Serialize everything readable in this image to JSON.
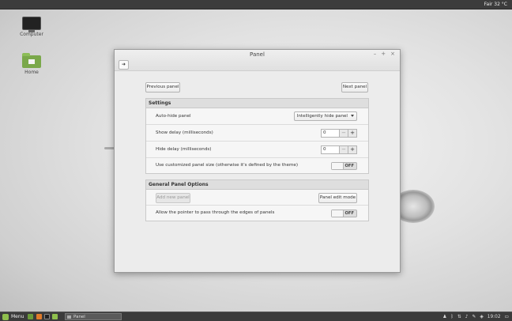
{
  "top_panel": {
    "weather": "Fair 32 °C"
  },
  "desktop": {
    "icons": [
      {
        "label": "Computer",
        "icon": "computer-icon"
      },
      {
        "label": "Home",
        "icon": "home-folder-icon"
      }
    ]
  },
  "window": {
    "title": "Panel",
    "controls": {
      "minimize": "–",
      "maximize": "+",
      "close": "×"
    },
    "back_glyph": "➜",
    "previous_panel": "Previous panel",
    "next_panel": "Next panel",
    "settings": {
      "heading": "Settings",
      "autohide_label": "Auto-hide panel",
      "autohide_value": "Intelligently hide panel",
      "show_delay_label": "Show delay (milliseconds)",
      "show_delay_value": "0",
      "hide_delay_label": "Hide delay (milliseconds)",
      "hide_delay_value": "0",
      "custom_size_label": "Use customized panel size (otherwise it's defined by the theme)",
      "custom_size_state": "OFF",
      "minus": "−",
      "plus": "+"
    },
    "general": {
      "heading": "General Panel Options",
      "add_new_panel": "Add new panel",
      "panel_edit_mode": "Panel edit mode",
      "pointer_label": "Allow the pointer to pass through the edges of panels",
      "pointer_state": "OFF"
    }
  },
  "bottom_panel": {
    "menu_label": "Menu",
    "task_label": "Panel",
    "clock": "19:02"
  },
  "colors": {
    "accent": "#8fbf4d",
    "panel_bg": "#3b3b3b",
    "window_bg": "#ececec"
  }
}
